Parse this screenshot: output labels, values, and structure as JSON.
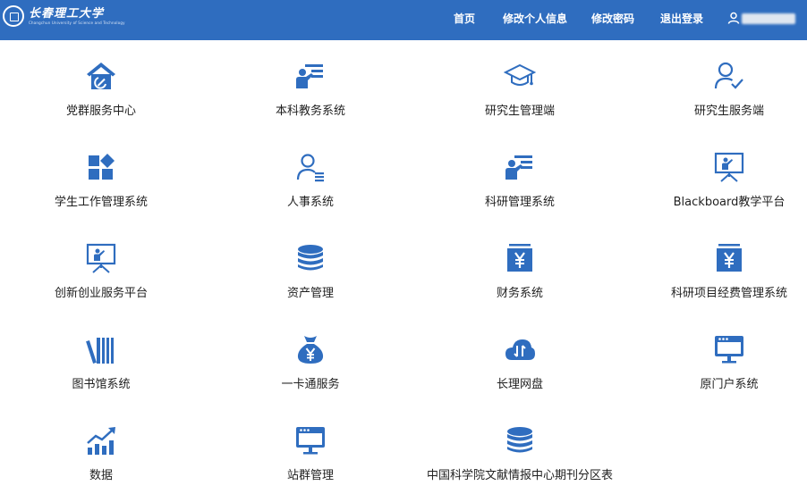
{
  "header": {
    "logo": {
      "name_cn": "长春理工大学",
      "name_en": "Changchun University of Science and Technology"
    },
    "nav": [
      "首页",
      "修改个人信息",
      "修改密码",
      "退出登录"
    ],
    "user": {
      "name": "",
      "icon": "user-icon"
    }
  },
  "colors": {
    "header_bg": "#2f6dbf",
    "icon": "#2f6dbf",
    "label": "#1f1f1f"
  },
  "apps": [
    {
      "label": "党群服务中心",
      "icon": "party-house-icon"
    },
    {
      "label": "本科教务系统",
      "icon": "teacher-board-icon"
    },
    {
      "label": "研究生管理端",
      "icon": "graduation-cap-icon"
    },
    {
      "label": "研究生服务端",
      "icon": "user-check-icon"
    },
    {
      "label": "学生工作管理系统",
      "icon": "apps-blocks-icon"
    },
    {
      "label": "人事系统",
      "icon": "user-list-icon"
    },
    {
      "label": "科研管理系统",
      "icon": "teacher-board-icon"
    },
    {
      "label": "Blackboard教学平台",
      "icon": "easel-presenter-icon"
    },
    {
      "label": "创新创业服务平台",
      "icon": "easel-presenter-icon"
    },
    {
      "label": "资产管理",
      "icon": "database-icon"
    },
    {
      "label": "财务系统",
      "icon": "yen-box-icon"
    },
    {
      "label": "科研项目经费管理系统",
      "icon": "yen-box-icon"
    },
    {
      "label": "图书馆系统",
      "icon": "books-icon"
    },
    {
      "label": "一卡通服务",
      "icon": "money-bag-icon"
    },
    {
      "label": "长理网盘",
      "icon": "cloud-transfer-icon"
    },
    {
      "label": "原门户系统",
      "icon": "monitor-icon"
    },
    {
      "label": "数据",
      "icon": "growth-chart-icon"
    },
    {
      "label": "站群管理",
      "icon": "monitor-icon"
    },
    {
      "label": "中国科学院文献情报中心期刊分区表",
      "icon": "database-icon"
    }
  ]
}
